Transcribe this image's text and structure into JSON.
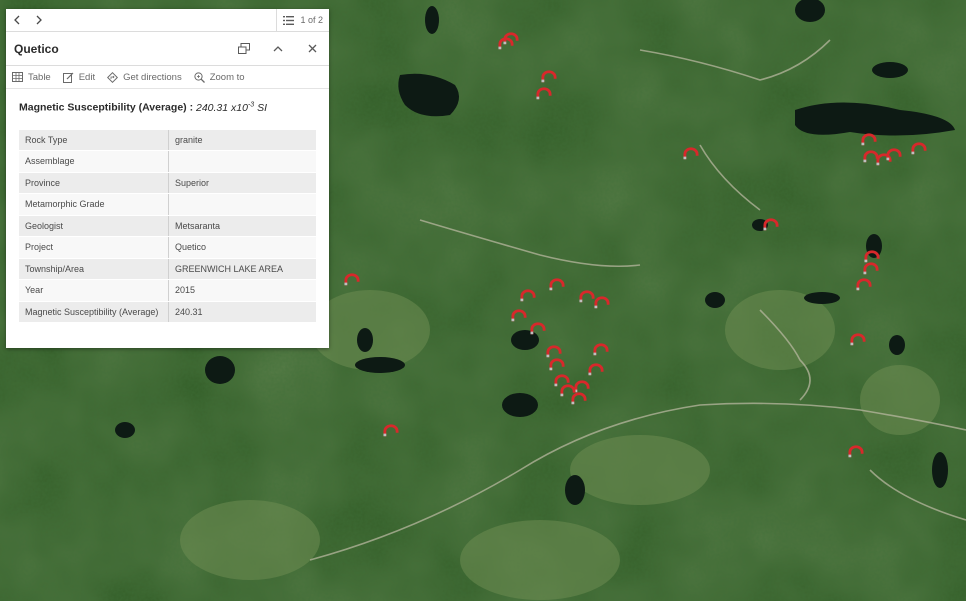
{
  "popup": {
    "pager": {
      "prev_icon": "chevron-left-icon",
      "next_icon": "chevron-right-icon",
      "count": "1 of 2"
    },
    "title": "Quetico",
    "actions": [
      {
        "label": "Table",
        "icon": "table-icon"
      },
      {
        "label": "Edit",
        "icon": "edit-icon"
      },
      {
        "label": "Get directions",
        "icon": "directions-icon"
      },
      {
        "label": "Zoom to",
        "icon": "zoom-to-icon"
      }
    ],
    "heading": {
      "label": "Magnetic Susceptibility (Average) : ",
      "value": "240.31 x10",
      "exponent": "-3",
      "unit": " SI"
    },
    "attributes": [
      {
        "key": "Rock Type",
        "value": "granite"
      },
      {
        "key": "Assemblage",
        "value": ""
      },
      {
        "key": "Province",
        "value": "Superior"
      },
      {
        "key": "Metamorphic Grade",
        "value": ""
      },
      {
        "key": "Geologist",
        "value": "Metsaranta"
      },
      {
        "key": "Project",
        "value": "Quetico"
      },
      {
        "key": "Township/Area",
        "value": "GREENWICH LAKE AREA"
      },
      {
        "key": "Year",
        "value": "2015"
      },
      {
        "key": "Magnetic Susceptibility (Average)",
        "value": "240.31"
      }
    ]
  },
  "map": {
    "marker_color": "#d8282b",
    "marker_icon": "horseshoe-magnet-icon"
  }
}
